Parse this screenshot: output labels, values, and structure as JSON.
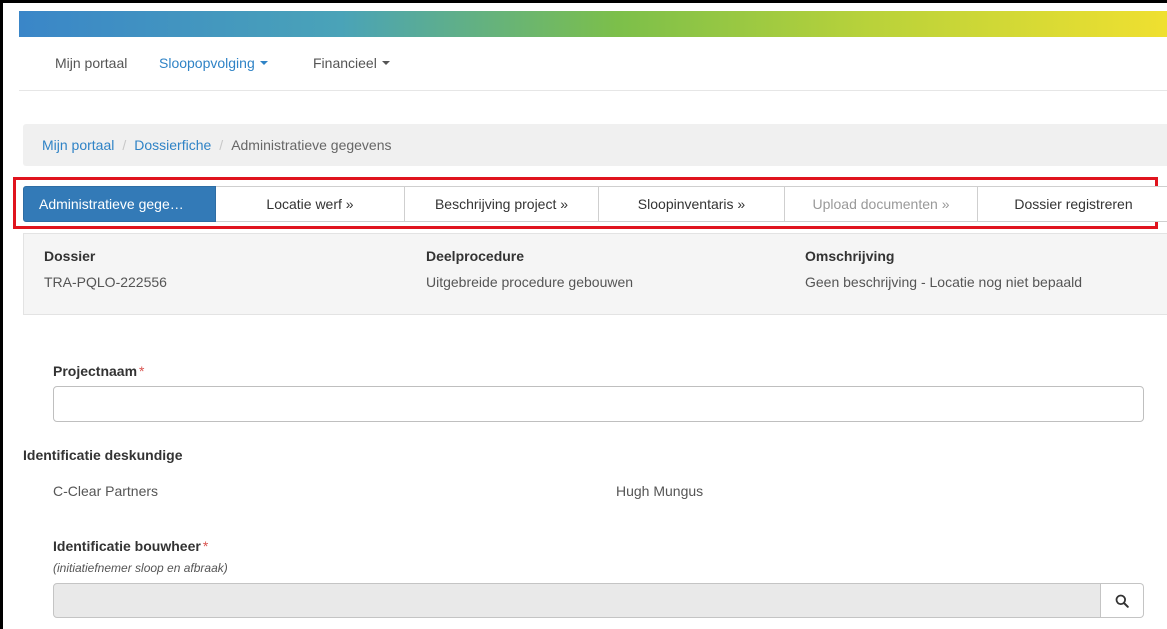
{
  "nav": {
    "items": [
      {
        "label": "Mijn portaal",
        "dropdown": false
      },
      {
        "label": "Sloopopvolging",
        "dropdown": true,
        "active": true
      },
      {
        "label": "Financieel",
        "dropdown": true
      }
    ]
  },
  "breadcrumb": {
    "items": [
      "Mijn portaal",
      "Dossierfiche"
    ],
    "current": "Administratieve gegevens"
  },
  "steps": [
    {
      "label": "Administratieve gege…",
      "state": "active"
    },
    {
      "label": "Locatie werf »",
      "state": "default"
    },
    {
      "label": "Beschrijving project »",
      "state": "default"
    },
    {
      "label": "Sloopinventaris »",
      "state": "default"
    },
    {
      "label": "Upload documenten »",
      "state": "disabled"
    },
    {
      "label": "Dossier registreren",
      "state": "default"
    }
  ],
  "info": {
    "dossier": {
      "label": "Dossier",
      "value": "TRA-PQLO-222556"
    },
    "deelprocedure": {
      "label": "Deelprocedure",
      "value": "Uitgebreide procedure gebouwen"
    },
    "omschrijving": {
      "label": "Omschrijving",
      "value": "Geen beschrijving - Locatie nog niet bepaald"
    }
  },
  "form": {
    "projectnaam": {
      "label": "Projectnaam",
      "required_mark": "*",
      "value": ""
    },
    "deskundige": {
      "label": "Identificatie deskundige",
      "company": "C-Clear Partners",
      "person": "Hugh Mungus"
    },
    "bouwheer": {
      "label": "Identificatie bouwheer",
      "required_mark": "*",
      "hint": "(initiatiefnemer sloop en afbraak)",
      "value": ""
    }
  },
  "icons": {
    "search": "search-icon"
  },
  "colors": {
    "accent": "#337ab7",
    "link": "#2f83c6",
    "highlight_outline": "#e0141e",
    "required": "#d9534f"
  }
}
